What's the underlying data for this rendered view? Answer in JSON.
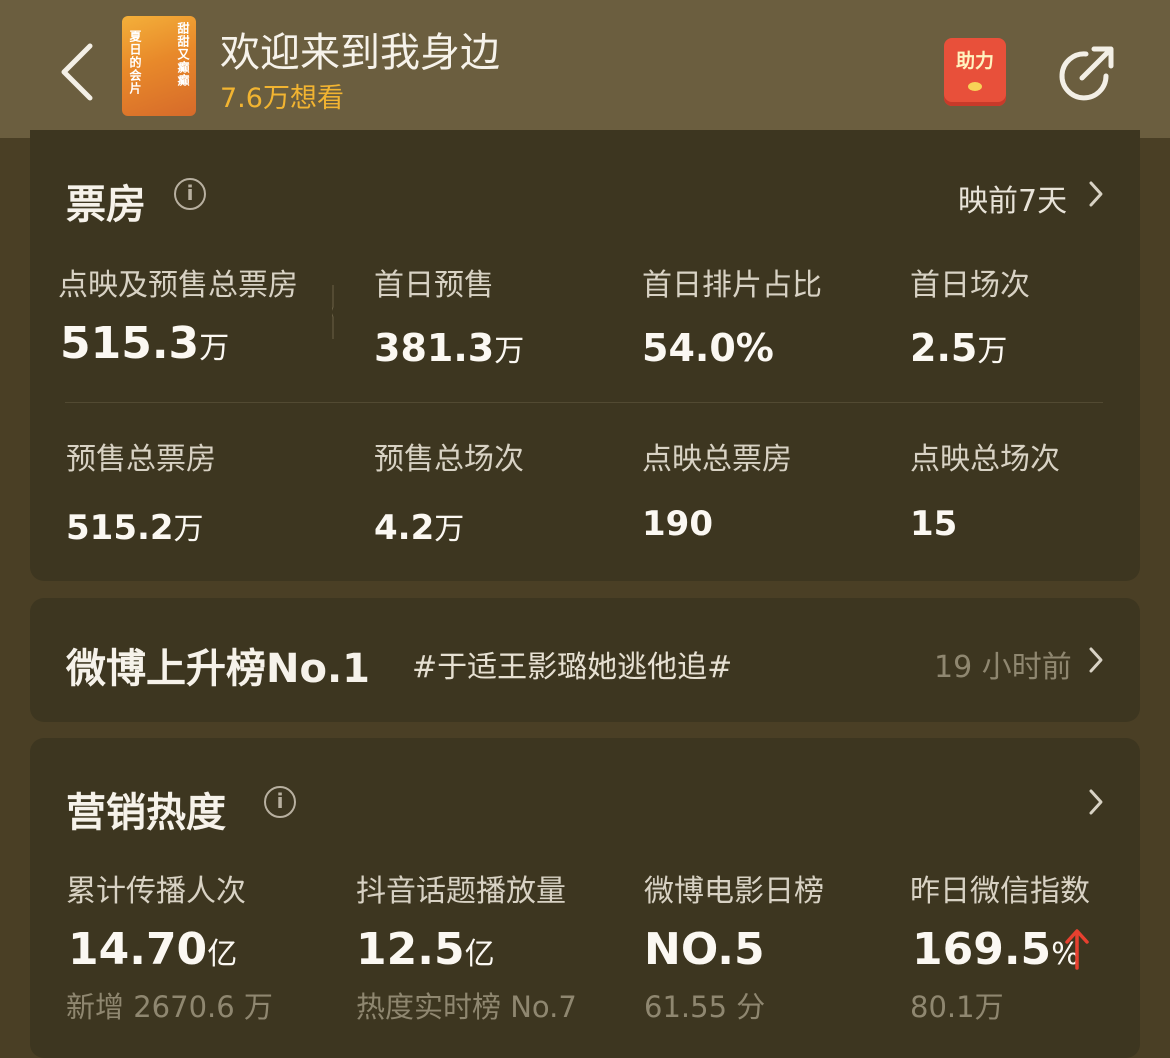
{
  "header": {
    "movie_title": "欢迎来到我身边",
    "want_count": "7.6万想看",
    "poster_text_left": "夏日的会片",
    "poster_text_right": "甜甜又癫癫",
    "help_label": "助力",
    "colors": {
      "header_bg": "#6b5e3f",
      "accent": "#f2b431",
      "help_bg": "#e8503a"
    }
  },
  "box_office": {
    "title": "票房",
    "period_link": "映前7天",
    "stats_row1": [
      {
        "label": "点映及预售总票房",
        "value": "515.3",
        "unit": "万"
      },
      {
        "label": "首日预售",
        "value": "381.3",
        "unit": "万"
      },
      {
        "label": "首日排片占比",
        "value": "54.0%",
        "unit": ""
      },
      {
        "label": "首日场次",
        "value": "2.5",
        "unit": "万"
      }
    ],
    "stats_row2": [
      {
        "label": "预售总票房",
        "value": "515.2",
        "unit": "万"
      },
      {
        "label": "预售总场次",
        "value": "4.2",
        "unit": "万"
      },
      {
        "label": "点映总票房",
        "value": "190",
        "unit": ""
      },
      {
        "label": "点映总场次",
        "value": "15",
        "unit": ""
      }
    ]
  },
  "weibo": {
    "title": "微博上升榜No.1",
    "topic": "#于适王影璐她逃他追#",
    "time_ago": "19 小时前"
  },
  "marketing": {
    "title": "营销热度",
    "stats": [
      {
        "label": "累计传播人次",
        "value": "14.70",
        "unit": "亿",
        "sub": "新增 2670.6 万"
      },
      {
        "label": "抖音话题播放量",
        "value": "12.5",
        "unit": "亿",
        "sub": "热度实时榜 No.7"
      },
      {
        "label": "微博电影日榜",
        "value": "NO.5",
        "unit": "",
        "sub": "61.55 分"
      },
      {
        "label": "昨日微信指数",
        "value": "169.5",
        "unit": "%",
        "sub": "80.1万",
        "trend_icon": "arrow-up-icon",
        "trend_color": "#e8402f"
      }
    ]
  }
}
